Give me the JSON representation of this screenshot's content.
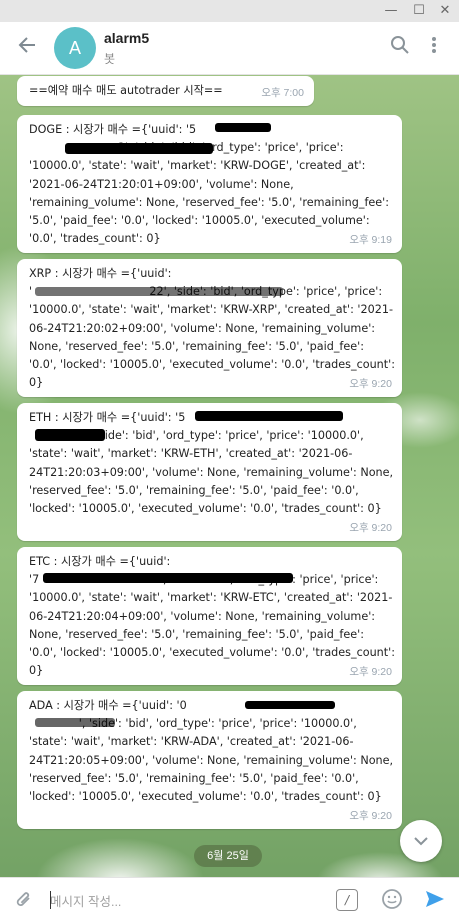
{
  "window": {
    "minimize_glyph": "—",
    "maximize_glyph": "☐",
    "close_glyph": "✕"
  },
  "header": {
    "avatar_letter": "A",
    "title": "alarm5",
    "subtitle": "봇"
  },
  "messages": [
    {
      "text": "==예약 매수 매도 autotrader 시작==",
      "time": "오후 7:00"
    },
    {
      "text": "DOGE : 시장가 매수 ={'uuid': '5\n                         2', 'side': 'bid', 'ord_type': 'price', 'price': '10000.0', 'state': 'wait', 'market': 'KRW-DOGE', 'created_at': '2021-06-24T21:20:01+09:00', 'volume': None, 'remaining_volume': None, 'reserved_fee': '5.0', 'remaining_fee': '5.0', 'paid_fee': '0.0', 'locked': '10005.0', 'executed_volume': '0.0', 'trades_count': 0}",
      "time": "오후 9:19"
    },
    {
      "text": "XRP : 시장가 매수 ={'uuid':\n'                                 22', 'side': 'bid', 'ord_type': 'price', 'price': '10000.0', 'state': 'wait', 'market': 'KRW-XRP', 'created_at': '2021-06-24T21:20:02+09:00', 'volume': None, 'remaining_volume': None, 'reserved_fee': '5.0', 'remaining_fee': '5.0', 'paid_fee': '0.0', 'locked': '10005.0', 'executed_volume': '0.0', 'trades_count': 0}",
      "time": "오후 9:20"
    },
    {
      "text": "ETH : 시장가 매수 ={'uuid': '5\n              a', 'side': 'bid', 'ord_type': 'price', 'price': '10000.0', 'state': 'wait', 'market': 'KRW-ETH', 'created_at': '2021-06-24T21:20:03+09:00', 'volume': None, 'remaining_volume': None, 'reserved_fee': '5.0', 'remaining_fee': '5.0', 'paid_fee': '0.0', 'locked': '10005.0', 'executed_volume': '0.0', 'trades_count': 0}",
      "time": "오후 9:20"
    },
    {
      "text": "ETC : 시장가 매수 ={'uuid':\n'7                                e', 'side': 'bid', 'ord_type': 'price', 'price': '10000.0', 'state': 'wait', 'market': 'KRW-ETC', 'created_at': '2021-06-24T21:20:04+09:00', 'volume': None, 'remaining_volume': None, 'reserved_fee': '5.0', 'remaining_fee': '5.0', 'paid_fee': '0.0', 'locked': '10005.0', 'executed_volume': '0.0', 'trades_count': 0}",
      "time": "오후 9:20"
    },
    {
      "text": "ADA : 시장가 매수 ={'uuid': '0\n              ', 'side': 'bid', 'ord_type': 'price', 'price': '10000.0', 'state': 'wait', 'market': 'KRW-ADA', 'created_at': '2021-06-24T21:20:05+09:00', 'volume': None, 'remaining_volume': None, 'reserved_fee': '5.0', 'remaining_fee': '5.0', 'paid_fee': '0.0', 'locked': '10005.0', 'executed_volume': '0.0', 'trades_count': 0}",
      "time": "오후 9:20"
    }
  ],
  "date_divider": "6월 25일",
  "input": {
    "placeholder": "메시지 작성..."
  },
  "icons": {
    "back": "back-arrow-icon",
    "search": "search-icon",
    "more": "more-vertical-icon",
    "scroll_down": "chevron-down-icon",
    "attach": "paperclip-icon",
    "bot_commands": "slash-command-icon",
    "emoji": "emoji-icon",
    "send": "send-icon"
  },
  "colors": {
    "avatar": "#5bc0c8",
    "send": "#3fa0ea",
    "time_text": "#9aa5b0"
  }
}
